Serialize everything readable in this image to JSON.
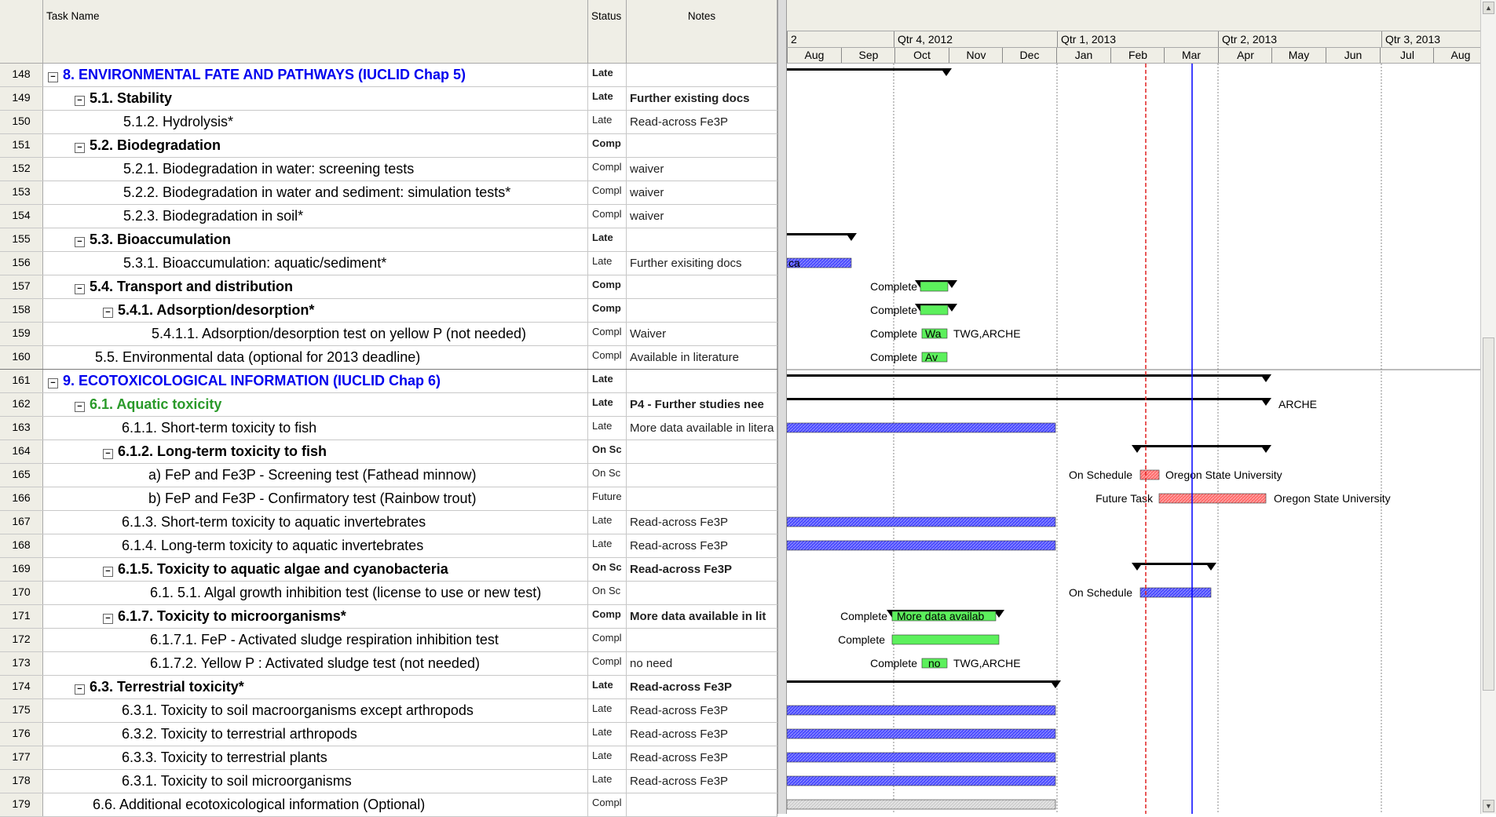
{
  "columns": {
    "task_name": "Task Name",
    "status": "Status",
    "notes": "Notes"
  },
  "timescale": {
    "quarters": [
      "2",
      "Qtr 4, 2012",
      "Qtr 1, 2013",
      "Qtr 2, 2013",
      "Qtr 3, 2013"
    ],
    "months": [
      "Aug",
      "Sep",
      "Oct",
      "Nov",
      "Dec",
      "Jan",
      "Feb",
      "Mar",
      "Apr",
      "May",
      "Jun",
      "Jul",
      "Aug"
    ]
  },
  "rows": [
    {
      "id": "148",
      "name": "8. ENVIRONMENTAL FATE AND PATHWAYS (IUCLID Chap 5)",
      "status": "Late",
      "notes": ""
    },
    {
      "id": "149",
      "name": "5.1. Stability",
      "status": "Late",
      "notes": "Further existing docs"
    },
    {
      "id": "150",
      "name": "5.1.2. Hydrolysis*",
      "status": "Late",
      "notes": "Read-across Fe3P"
    },
    {
      "id": "151",
      "name": "5.2. Biodegradation",
      "status": "Comp",
      "notes": ""
    },
    {
      "id": "152",
      "name": "5.2.1. Biodegradation in water: screening tests",
      "status": "Compl",
      "notes": "waiver"
    },
    {
      "id": "153",
      "name": "5.2.2. Biodegradation in water and sediment: simulation tests*",
      "status": "Compl",
      "notes": "waiver"
    },
    {
      "id": "154",
      "name": "5.2.3. Biodegradation in soil*",
      "status": "Compl",
      "notes": "waiver"
    },
    {
      "id": "155",
      "name": "5.3. Bioaccumulation",
      "status": "Late",
      "notes": ""
    },
    {
      "id": "156",
      "name": "5.3.1. Bioaccumulation: aquatic/sediment*",
      "status": "Late",
      "notes": "Further exisiting docs"
    },
    {
      "id": "157",
      "name": "5.4. Transport and distribution",
      "status": "Comp",
      "notes": ""
    },
    {
      "id": "158",
      "name": "5.4.1. Adsorption/desorption*",
      "status": "Comp",
      "notes": ""
    },
    {
      "id": "159",
      "name": "5.4.1.1. Adsorption/desorption test on yellow P (not needed)",
      "status": "Compl",
      "notes": "Waiver"
    },
    {
      "id": "160",
      "name": "5.5. Environmental data (optional for 2013 deadline)",
      "status": "Compl",
      "notes": "Available in literature"
    },
    {
      "id": "161",
      "name": "9. ECOTOXICOLOGICAL INFORMATION (IUCLID Chap 6)",
      "status": "Late",
      "notes": ""
    },
    {
      "id": "162",
      "name": "6.1. Aquatic toxicity",
      "status": "Late",
      "notes": "P4 - Further studies nee"
    },
    {
      "id": "163",
      "name": "6.1.1. Short-term toxicity to fish",
      "status": "Late",
      "notes": "More data available in litera"
    },
    {
      "id": "164",
      "name": "6.1.2. Long-term toxicity to fish",
      "status": "On Sc",
      "notes": ""
    },
    {
      "id": "165",
      "name": "a) FeP and Fe3P -  Screening test  (Fathead minnow)",
      "status": "On Sc",
      "notes": ""
    },
    {
      "id": "166",
      "name": "b)  FeP and Fe3P -  Confirmatory test (Rainbow trout)",
      "status": "Future",
      "notes": ""
    },
    {
      "id": "167",
      "name": "6.1.3. Short-term toxicity to aquatic invertebrates",
      "status": "Late",
      "notes": "Read-across Fe3P"
    },
    {
      "id": "168",
      "name": "6.1.4. Long-term toxicity to aquatic invertebrates",
      "status": "Late",
      "notes": "Read-across Fe3P"
    },
    {
      "id": "169",
      "name": "6.1.5. Toxicity to aquatic algae and cyanobacteria",
      "status": "On Sc",
      "notes": "Read-across Fe3P"
    },
    {
      "id": "170",
      "name": "6.1. 5.1. Algal growth inhibition test (license to use or new test)",
      "status": "On Sc",
      "notes": ""
    },
    {
      "id": "171",
      "name": "6.1.7. Toxicity to microorganisms*",
      "status": "Comp",
      "notes": "More data available in lit"
    },
    {
      "id": "172",
      "name": "6.1.7.1. FeP - Activated sludge respiration inhibition test",
      "status": "Compl",
      "notes": ""
    },
    {
      "id": "173",
      "name": "6.1.7.2. Yellow P : Activated sludge test (not needed)",
      "status": "Compl",
      "notes": "no need"
    },
    {
      "id": "174",
      "name": "6.3. Terrestrial toxicity*",
      "status": "Late",
      "notes": "Read-across Fe3P"
    },
    {
      "id": "175",
      "name": "6.3.1. Toxicity to soil macroorganisms except arthropods",
      "status": "Late",
      "notes": "Read-across Fe3P"
    },
    {
      "id": "176",
      "name": "6.3.2. Toxicity to terrestrial arthropods",
      "status": "Late",
      "notes": "Read-across Fe3P"
    },
    {
      "id": "177",
      "name": "6.3.3. Toxicity to terrestrial plants",
      "status": "Late",
      "notes": "Read-across Fe3P"
    },
    {
      "id": "178",
      "name": "6.3.1. Toxicity to soil microorganisms",
      "status": "Late",
      "notes": "Read-across Fe3P"
    },
    {
      "id": "179",
      "name": "6.6. Additional ecotoxicological information (Optional)",
      "status": "Compl",
      "notes": ""
    }
  ],
  "gantt_labels": {
    "r156": "ca",
    "r157_left": "Complete",
    "r158_left": "Complete",
    "r159_left": "Complete",
    "r159_in": "Wa",
    "r159_right": "TWG,ARCHE",
    "r160_left": "Complete",
    "r160_in": "Av",
    "r162_right": "ARCHE",
    "r165_left": "On Schedule",
    "r165_right": "Oregon State University",
    "r166_left": "Future Task",
    "r166_right": "Oregon State University",
    "r170_left": "On Schedule",
    "r171_left": "Complete",
    "r171_in": "More data availab",
    "r172_left": "Complete",
    "r173_left": "Complete",
    "r173_in": "no",
    "r173_right": "TWG,ARCHE"
  },
  "colors": {
    "late_bar": "#4a4aff",
    "complete_bar": "#5cf05c",
    "future_bar": "#ff6b6b",
    "status_date_line": "#0000ff",
    "deadline_line": "#e02020",
    "summary_bar": "#000000"
  }
}
